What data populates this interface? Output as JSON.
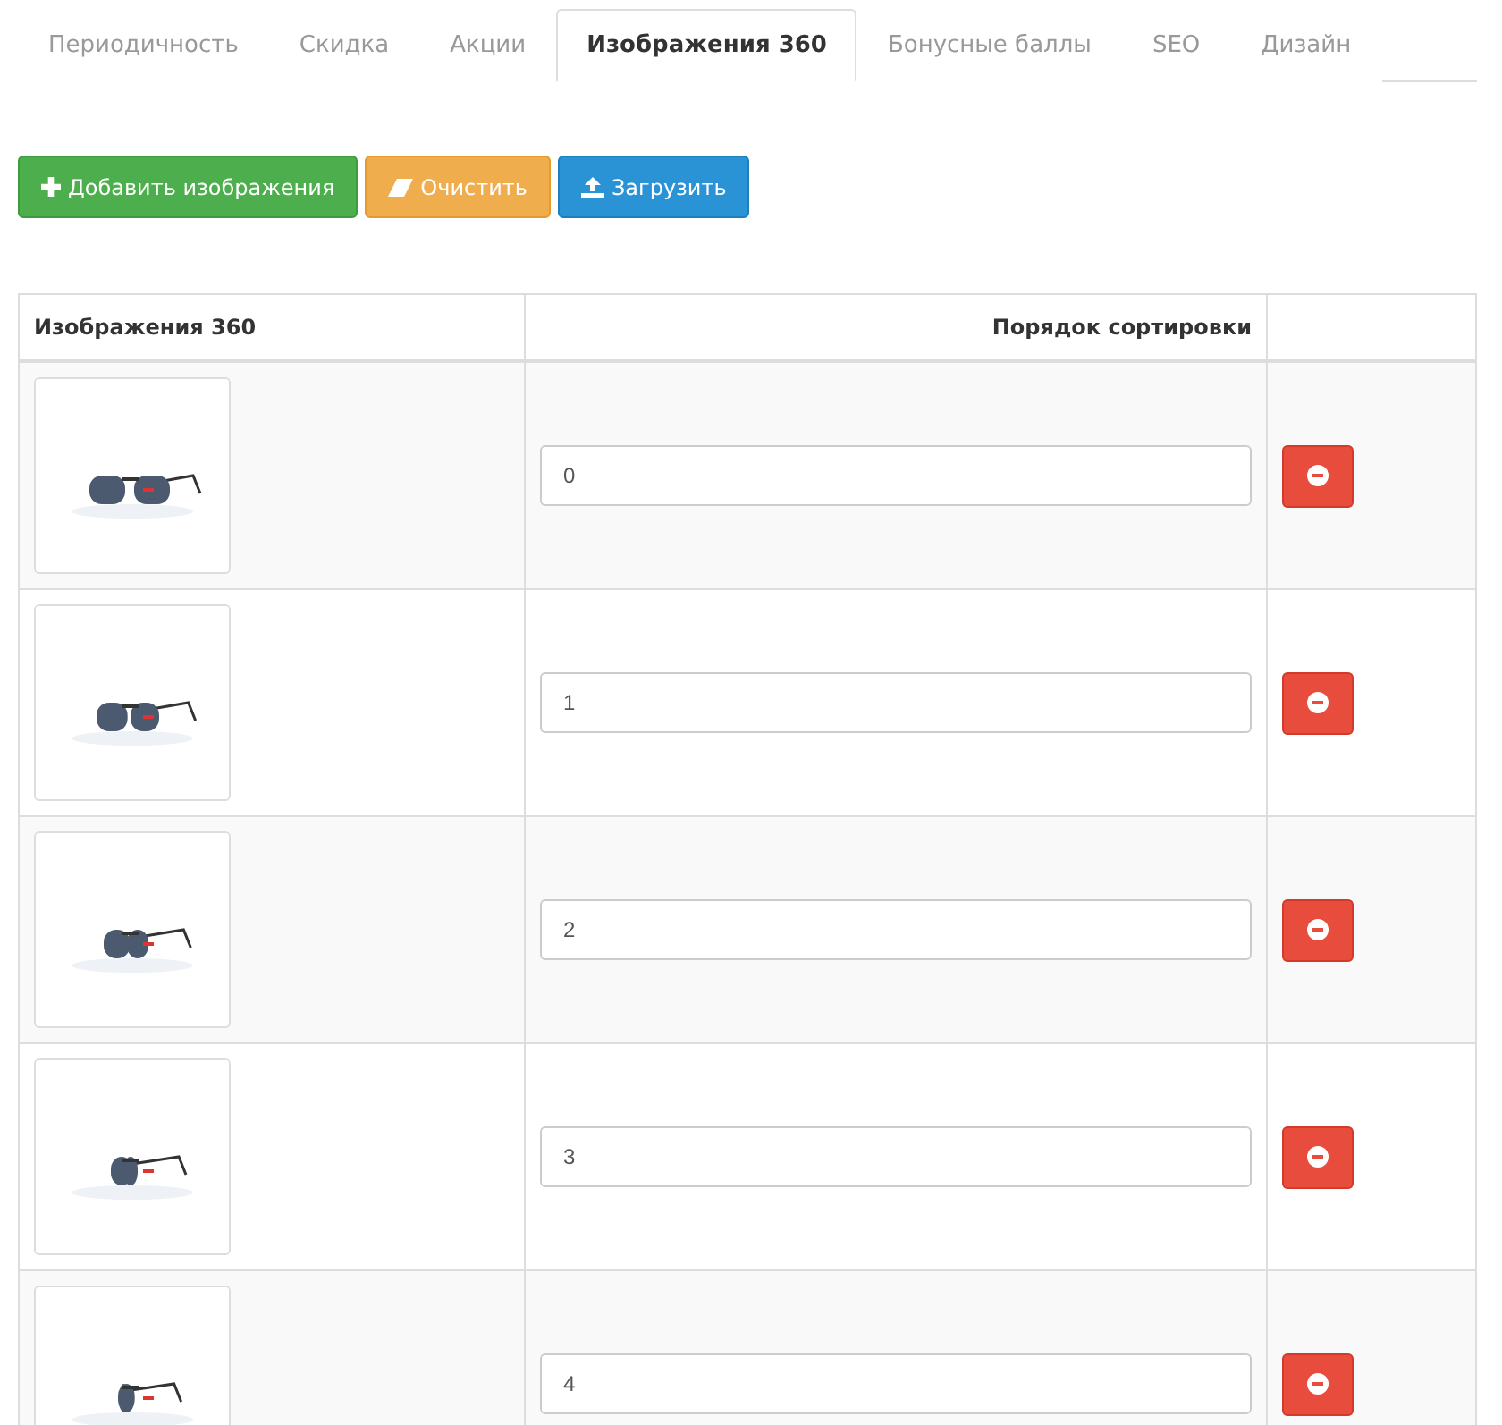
{
  "tabs": [
    {
      "label": "Периодичность",
      "selected": false
    },
    {
      "label": "Скидка",
      "selected": false
    },
    {
      "label": "Акции",
      "selected": false
    },
    {
      "label": "Изображения 360",
      "selected": true
    },
    {
      "label": "Бонусные баллы",
      "selected": false
    },
    {
      "label": "SEO",
      "selected": false
    },
    {
      "label": "Дизайн",
      "selected": false
    }
  ],
  "buttons": [
    {
      "label": "Добавить изображения",
      "kind": "add"
    },
    {
      "label": "Очистить",
      "kind": "clear"
    },
    {
      "label": "Загрузить",
      "kind": "upload"
    }
  ],
  "table": {
    "columns": [
      "Изображения 360",
      "Порядок сортировки"
    ],
    "rows": [
      {
        "sort_order": "0"
      },
      {
        "sort_order": "1"
      },
      {
        "sort_order": "2"
      },
      {
        "sort_order": "3"
      },
      {
        "sort_order": "4"
      }
    ]
  }
}
